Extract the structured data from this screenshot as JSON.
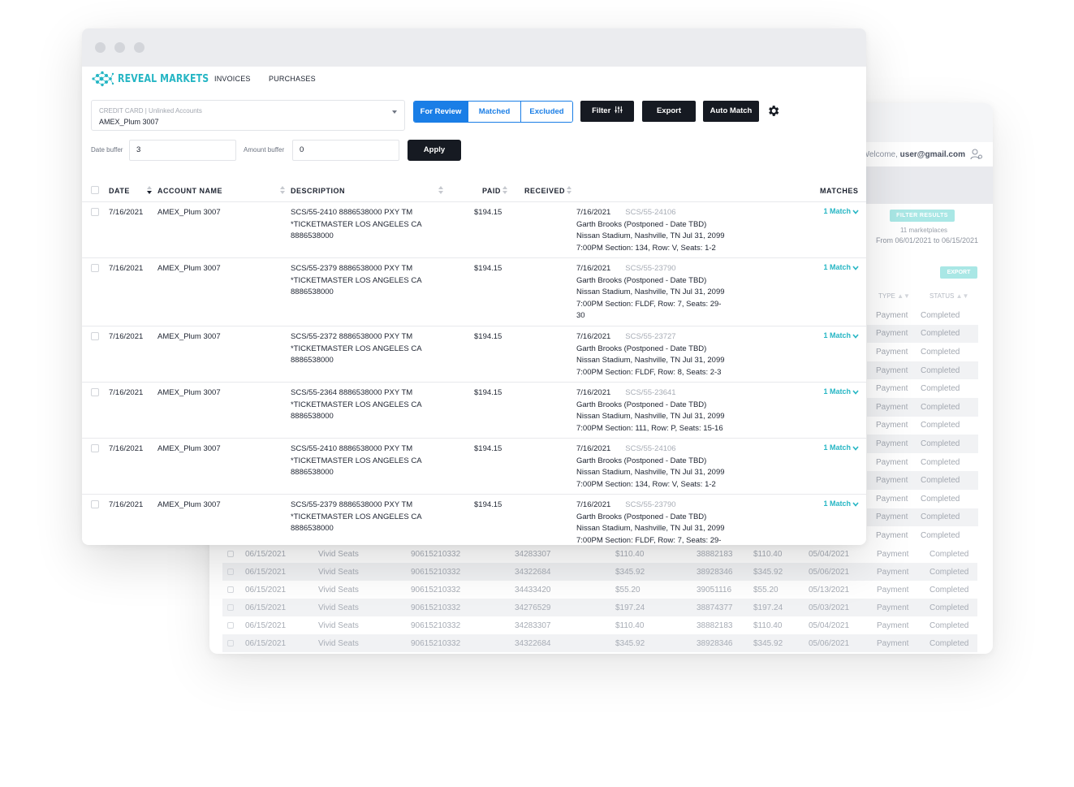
{
  "back_window": {
    "welcome_prefix": "Welcome,",
    "welcome_user": "user@gmail.com",
    "filter_results_label": "FILTER RESULTS",
    "marketplaces": "11 marketplaces",
    "date_range": "From 06/01/2021 to 06/15/2021",
    "export_label": "EXPORT",
    "col_type": "TYPE",
    "col_status": "STATUS",
    "side_rows": [
      {
        "type": "Payment",
        "status": "Completed"
      },
      {
        "type": "Payment",
        "status": "Completed"
      },
      {
        "type": "Payment",
        "status": "Completed"
      },
      {
        "type": "Payment",
        "status": "Completed"
      },
      {
        "type": "Payment",
        "status": "Completed"
      },
      {
        "type": "Payment",
        "status": "Completed"
      },
      {
        "type": "Payment",
        "status": "Completed"
      },
      {
        "type": "Payment",
        "status": "Completed"
      },
      {
        "type": "Payment",
        "status": "Completed"
      },
      {
        "type": "Payment",
        "status": "Completed"
      },
      {
        "type": "Payment",
        "status": "Completed"
      },
      {
        "type": "Payment",
        "status": "Completed"
      },
      {
        "type": "Payment",
        "status": "Completed"
      }
    ],
    "rows": [
      {
        "date": "06/15/2021",
        "market": "Vivid Seats",
        "acct": "90615210332",
        "order": "34283307",
        "amount": "$110.40",
        "ref": "38882183",
        "amount2": "$110.40",
        "paid_date": "05/04/2021",
        "type": "Payment",
        "status": "Completed"
      },
      {
        "date": "06/15/2021",
        "market": "Vivid Seats",
        "acct": "90615210332",
        "order": "34322684",
        "amount": "$345.92",
        "ref": "38928346",
        "amount2": "$345.92",
        "paid_date": "05/06/2021",
        "type": "Payment",
        "status": "Completed"
      },
      {
        "date": "06/15/2021",
        "market": "Vivid Seats",
        "acct": "90615210332",
        "order": "34433420",
        "amount": "$55.20",
        "ref": "39051116",
        "amount2": "$55.20",
        "paid_date": "05/13/2021",
        "type": "Payment",
        "status": "Completed"
      },
      {
        "date": "06/15/2021",
        "market": "Vivid Seats",
        "acct": "90615210332",
        "order": "34276529",
        "amount": "$197.24",
        "ref": "38874377",
        "amount2": "$197.24",
        "paid_date": "05/03/2021",
        "type": "Payment",
        "status": "Completed"
      },
      {
        "date": "06/15/2021",
        "market": "Vivid Seats",
        "acct": "90615210332",
        "order": "34283307",
        "amount": "$110.40",
        "ref": "38882183",
        "amount2": "$110.40",
        "paid_date": "05/04/2021",
        "type": "Payment",
        "status": "Completed"
      },
      {
        "date": "06/15/2021",
        "market": "Vivid Seats",
        "acct": "90615210332",
        "order": "34322684",
        "amount": "$345.92",
        "ref": "38928346",
        "amount2": "$345.92",
        "paid_date": "05/06/2021",
        "type": "Payment",
        "status": "Completed"
      }
    ]
  },
  "front_window": {
    "brand": "REVEAL MARKETS",
    "nav": {
      "invoices": "INVOICES",
      "purchases": "PURCHASES"
    },
    "account": {
      "label": "CREDIT CARD | Unlinked Accounts",
      "value": "AMEX_Plum 3007"
    },
    "tabs": {
      "review": "For Review",
      "matched": "Matched",
      "excluded": "Excluded"
    },
    "buttons": {
      "filter": "Filter",
      "export": "Export",
      "auto_match": "Auto Match",
      "apply": "Apply"
    },
    "buffers": {
      "date_label": "Date buffer",
      "date_value": "3",
      "amount_label": "Amount buffer",
      "amount_value": "0"
    },
    "columns": {
      "date": "DATE",
      "account": "ACCOUNT NAME",
      "description": "DESCRIPTION",
      "paid": "PAID",
      "received": "RECEIVED",
      "matches": "MATCHES"
    },
    "rows": [
      {
        "date": "7/16/2021",
        "account": "AMEX_Plum 3007",
        "desc1": "SCS/55-2410 8886538000 PXY TM",
        "desc2": "*TICKETMASTER LOS ANGELES CA",
        "desc3": "8886538000",
        "paid": "$194.15",
        "inv_date": "7/16/2021",
        "inv_code": "SCS/55-24106",
        "inv1": "Garth Brooks (Postponed - Date TBD)",
        "inv2": "Nissan Stadium, Nashville, TN Jul 31, 2099",
        "inv3": "7:00PM Section: 134, Row: V, Seats: 1-2",
        "inv4": "",
        "match": "1 Match"
      },
      {
        "date": "7/16/2021",
        "account": "AMEX_Plum 3007",
        "desc1": "SCS/55-2379 8886538000 PXY TM",
        "desc2": "*TICKETMASTER LOS ANGELES CA",
        "desc3": "8886538000",
        "paid": "$194.15",
        "inv_date": "7/16/2021",
        "inv_code": "SCS/55-23790",
        "inv1": "Garth Brooks (Postponed - Date TBD)",
        "inv2": "Nissan Stadium, Nashville, TN Jul 31, 2099",
        "inv3": "7:00PM Section: FLDF, Row: 7, Seats: 29-",
        "inv4": "30",
        "match": "1 Match"
      },
      {
        "date": "7/16/2021",
        "account": "AMEX_Plum 3007",
        "desc1": "SCS/55-2372 8886538000 PXY TM",
        "desc2": "*TICKETMASTER LOS ANGELES CA",
        "desc3": "8886538000",
        "paid": "$194.15",
        "inv_date": "7/16/2021",
        "inv_code": "SCS/55-23727",
        "inv1": "Garth Brooks (Postponed - Date TBD)",
        "inv2": "Nissan Stadium, Nashville, TN Jul 31, 2099",
        "inv3": "7:00PM Section: FLDF, Row: 8, Seats: 2-3",
        "inv4": "",
        "match": "1 Match"
      },
      {
        "date": "7/16/2021",
        "account": "AMEX_Plum 3007",
        "desc1": "SCS/55-2364 8886538000 PXY TM",
        "desc2": "*TICKETMASTER LOS ANGELES CA",
        "desc3": "8886538000",
        "paid": "$194.15",
        "inv_date": "7/16/2021",
        "inv_code": "SCS/55-23641",
        "inv1": "Garth Brooks (Postponed - Date TBD)",
        "inv2": "Nissan Stadium, Nashville, TN Jul 31, 2099",
        "inv3": "7:00PM Section: 111, Row: P, Seats: 15-16",
        "inv4": "",
        "match": "1 Match"
      },
      {
        "date": "7/16/2021",
        "account": "AMEX_Plum 3007",
        "desc1": "SCS/55-2410 8886538000 PXY TM",
        "desc2": "*TICKETMASTER LOS ANGELES CA",
        "desc3": "8886538000",
        "paid": "$194.15",
        "inv_date": "7/16/2021",
        "inv_code": "SCS/55-24106",
        "inv1": "Garth Brooks (Postponed - Date TBD)",
        "inv2": "Nissan Stadium, Nashville, TN Jul 31, 2099",
        "inv3": "7:00PM Section: 134, Row: V, Seats: 1-2",
        "inv4": "",
        "match": "1 Match"
      },
      {
        "date": "7/16/2021",
        "account": "AMEX_Plum 3007",
        "desc1": "SCS/55-2379 8886538000 PXY TM",
        "desc2": "*TICKETMASTER LOS ANGELES CA",
        "desc3": "8886538000",
        "paid": "$194.15",
        "inv_date": "7/16/2021",
        "inv_code": "SCS/55-23790",
        "inv1": "Garth Brooks (Postponed - Date TBD)",
        "inv2": "Nissan Stadium, Nashville, TN Jul 31, 2099",
        "inv3": "7:00PM Section: FLDF, Row: 7, Seats: 29-",
        "inv4": "",
        "match": "1 Match"
      }
    ]
  },
  "colors": {
    "brand": "#26b6c4",
    "primary": "#1a7ee6",
    "dark": "#161a22"
  }
}
